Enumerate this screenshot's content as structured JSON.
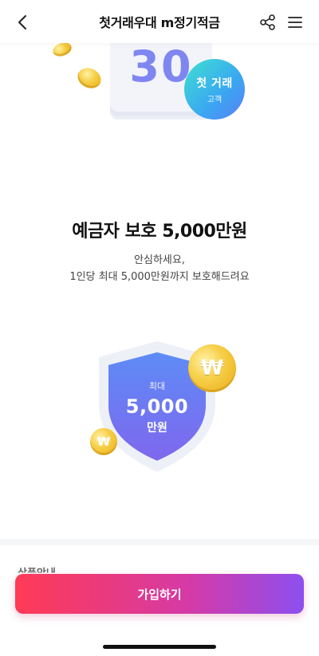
{
  "header": {
    "title": "첫거래우대 m정기적금",
    "icons": [
      "back-arrow-icon",
      "share-icon",
      "hamburger-menu-icon"
    ]
  },
  "hero": {
    "calendar_number": "30",
    "badge_line1": "첫 거래",
    "badge_line2": "고객"
  },
  "protection": {
    "title": "예금자 보호 5,000만원",
    "desc_line1": "안심하세요,",
    "desc_line2": "1인당 최대 5,000만원까지 보호해드려요",
    "shield_label_small": "최대",
    "shield_amount": "5,000",
    "shield_unit": "만원",
    "coin_symbol": "₩"
  },
  "lower": {
    "section_label": "상품안내"
  },
  "cta": {
    "label": "가입하기"
  },
  "colors": {
    "cta_gradient_start": "#ff3a55",
    "cta_gradient_end": "#8d4ff0",
    "shield": "#6b7ff3",
    "coin": "#f7d04a",
    "badge": "#3aa7f2"
  }
}
